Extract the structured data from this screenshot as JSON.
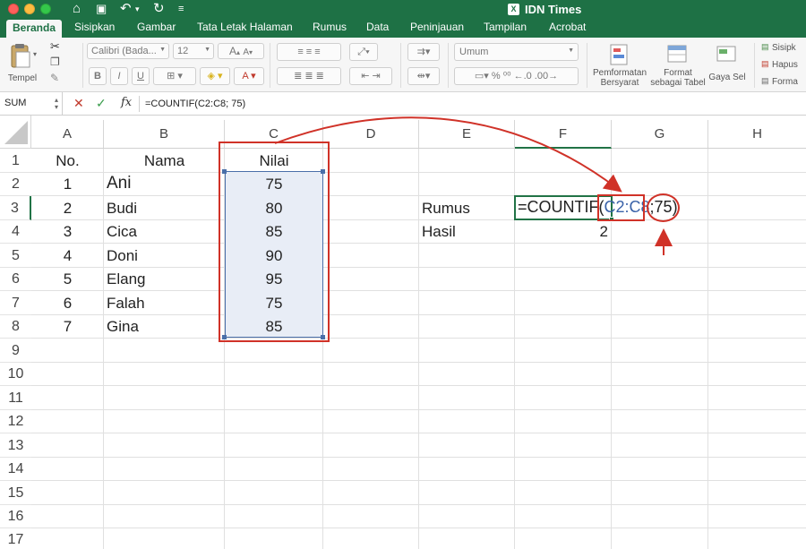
{
  "window": {
    "app_title": "IDN Times",
    "doc_icon": "X"
  },
  "tabs": [
    "Beranda",
    "Sisipkan",
    "Gambar",
    "Tata Letak Halaman",
    "Rumus",
    "Data",
    "Peninjauan",
    "Tampilan",
    "Acrobat"
  ],
  "ribbon": {
    "paste_label": "Tempel",
    "font_name": "Calibri (Bada...",
    "font_size": "12",
    "number_format": "Umum",
    "cond_format_1": "Pemformatan",
    "cond_format_2": "Bersyarat",
    "format_table_1": "Format",
    "format_table_2": "sebagai Tabel",
    "cell_styles": "Gaya Sel",
    "insert": "Sisipk",
    "delete": "Hapus",
    "format": "Forma"
  },
  "formula_bar": {
    "name_box": "SUM",
    "fx": "fx",
    "formula": "=COUNTIF(C2:C8; 75)"
  },
  "columns": [
    "A",
    "B",
    "C",
    "D",
    "E",
    "F",
    "G",
    "H"
  ],
  "rows": [
    "1",
    "2",
    "3",
    "4",
    "5",
    "6",
    "7",
    "8",
    "9",
    "10",
    "11",
    "12",
    "13",
    "14",
    "15",
    "16",
    "17"
  ],
  "cells": {
    "a1": "No.",
    "b1": "Nama",
    "c1": "Nilai",
    "a2": "1",
    "b2": "Ani",
    "c2": "75",
    "a3": "2",
    "b3": "Budi",
    "c3": "80",
    "a4": "3",
    "b4": "Cica",
    "c4": "85",
    "a5": "4",
    "b5": "Doni",
    "c5": "90",
    "a6": "5",
    "b6": "Elang",
    "c6": "95",
    "a7": "6",
    "b7": "Falah",
    "c7": "75",
    "a8": "7",
    "b8": "Gina",
    "c8": "85",
    "e3": "Rumus",
    "e4": "Hasil",
    "f4": "2"
  },
  "formula_cell": {
    "prefix": "=COUNTIF(",
    "ref": "C2:C8",
    "sep": ";",
    "criteria": "75",
    "close": ")"
  },
  "colors": {
    "excel_green": "#1e7145",
    "annotation_red": "#d03228",
    "range_blue": "#4a6fa9",
    "range_fill": "#e8edf6"
  }
}
